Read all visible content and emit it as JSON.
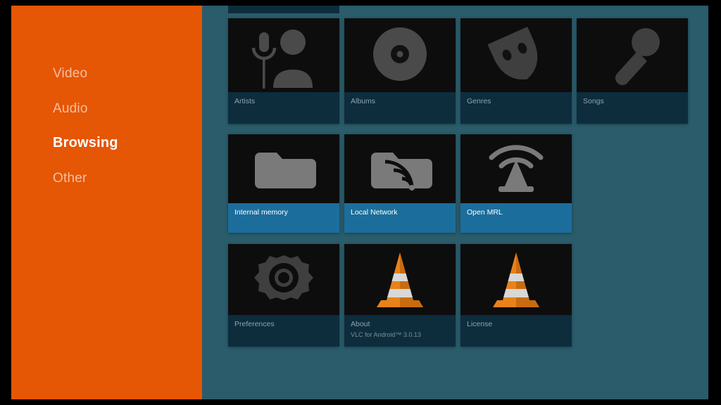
{
  "app": {
    "name": "VLC for Android",
    "background_color": "#2a5c6b",
    "sidebar_color": "#e55605",
    "selected_band_color": "#1b6e9c",
    "band_color": "#0d2d3d",
    "tile_art_color": "#0d0d0d"
  },
  "sidebar": {
    "items": [
      {
        "label": "Video",
        "active": false
      },
      {
        "label": "Audio",
        "active": false
      },
      {
        "label": "Browsing",
        "active": true
      },
      {
        "label": "Other",
        "active": false
      }
    ]
  },
  "grid": {
    "rows": [
      {
        "name": "audio-categories",
        "tiles": [
          {
            "label": "Artists",
            "sublabel": "",
            "icon": "artist-icon",
            "selected": false
          },
          {
            "label": "Albums",
            "sublabel": "",
            "icon": "album-disc-icon",
            "selected": false
          },
          {
            "label": "Genres",
            "sublabel": "",
            "icon": "theater-mask-icon",
            "selected": false
          },
          {
            "label": "Songs",
            "sublabel": "",
            "icon": "microphone-icon",
            "selected": false
          }
        ]
      },
      {
        "name": "browsing-sources",
        "tiles": [
          {
            "label": "Internal memory",
            "sublabel": "",
            "icon": "folder-icon",
            "selected": true
          },
          {
            "label": "Local Network",
            "sublabel": "",
            "icon": "folder-network-icon",
            "selected": true
          },
          {
            "label": "Open MRL",
            "sublabel": "",
            "icon": "stream-cone-icon",
            "selected": true
          }
        ]
      },
      {
        "name": "settings-and-info",
        "tiles": [
          {
            "label": "Preferences",
            "sublabel": "",
            "icon": "gear-icon",
            "selected": false
          },
          {
            "label": "About",
            "sublabel": "VLC for Android™ 3.0.13",
            "icon": "vlc-cone-icon",
            "selected": false
          },
          {
            "label": "License",
            "sublabel": "",
            "icon": "vlc-cone-icon",
            "selected": false
          }
        ]
      }
    ]
  }
}
